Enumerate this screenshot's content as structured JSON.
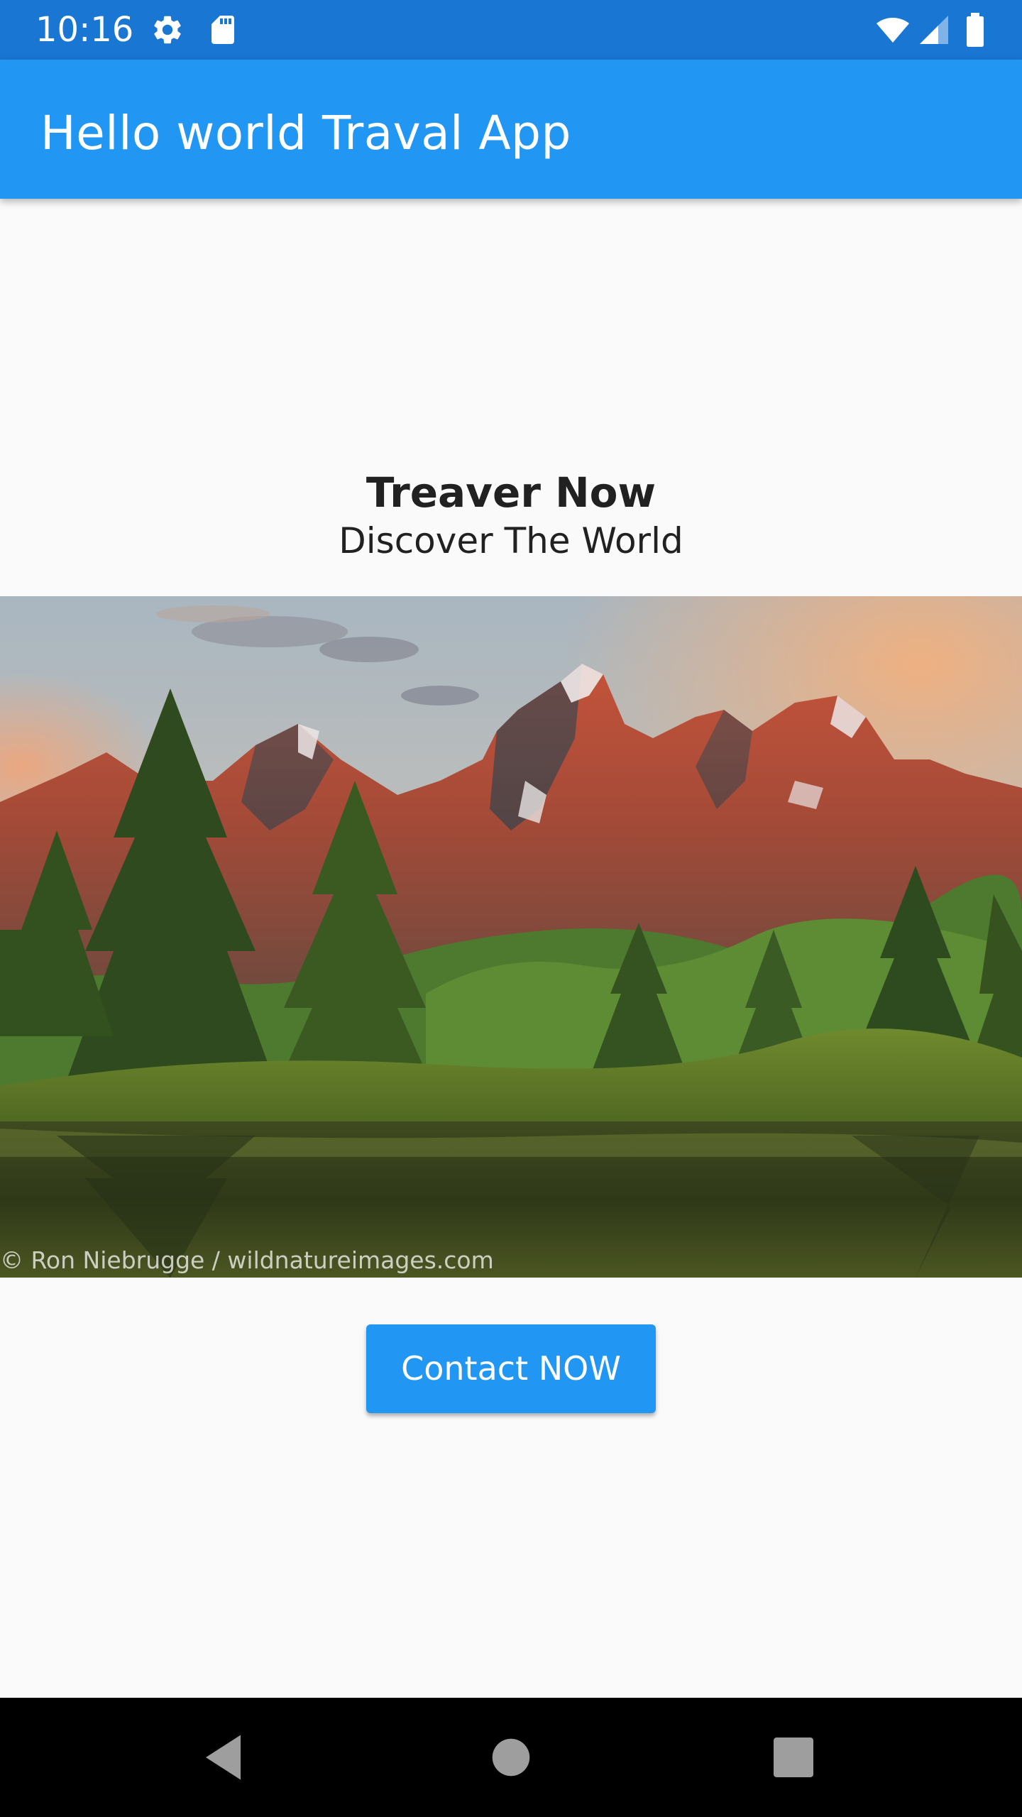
{
  "status_bar": {
    "time": "10:16",
    "icons": [
      "settings-icon",
      "sd-card-icon",
      "wifi-icon",
      "signal-icon",
      "battery-icon"
    ]
  },
  "app_bar": {
    "title": "Hello world Traval App"
  },
  "main": {
    "headline": "Treaver Now",
    "subheadline": "Discover The World",
    "hero_image": {
      "subject": "mountain-landscape",
      "credit": "© Ron Niebrugge / wildnatureimages.com"
    },
    "contact_button_label": "Contact NOW"
  },
  "nav_bar": {
    "buttons": [
      "back-icon",
      "home-icon",
      "recents-icon"
    ]
  },
  "colors": {
    "status_bar": "#1976d2",
    "app_bar": "#2196f3",
    "accent": "#2196f3",
    "background": "#fafafa",
    "text": "#212121",
    "nav_bar": "#000000"
  }
}
